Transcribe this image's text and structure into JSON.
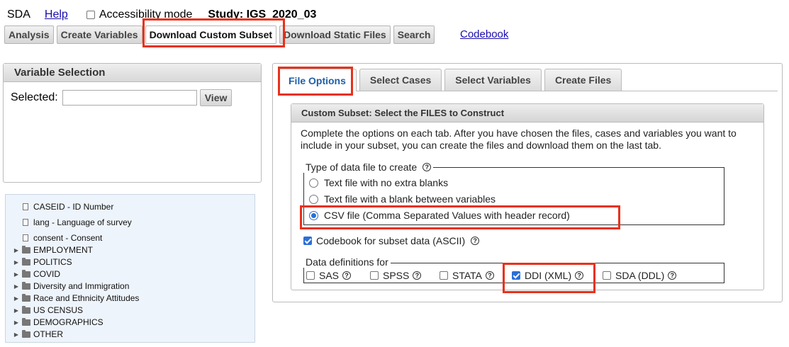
{
  "header": {
    "app_name": "SDA",
    "help_link": "Help",
    "accessibility_label": "Accessibility mode",
    "study_label": "Study: IGS_2020_03"
  },
  "toolbar": {
    "buttons": [
      "Analysis",
      "Create Variables",
      "Download Custom Subset",
      "Download Static Files",
      "Search"
    ],
    "codebook_link": "Codebook"
  },
  "variable_selection": {
    "title": "Variable Selection",
    "selected_label": "Selected:",
    "selected_value": "",
    "view_button": "View"
  },
  "tree": {
    "items": [
      {
        "label": "CASEID - ID Number",
        "kind": "variable"
      },
      {
        "label": "lang - Language of survey",
        "kind": "variable"
      },
      {
        "label": "consent - Consent",
        "kind": "variable"
      },
      {
        "label": "EMPLOYMENT",
        "kind": "folder"
      },
      {
        "label": "POLITICS",
        "kind": "folder"
      },
      {
        "label": "COVID",
        "kind": "folder"
      },
      {
        "label": "Diversity and Immigration",
        "kind": "folder"
      },
      {
        "label": "Race and Ethnicity Attitudes",
        "kind": "folder"
      },
      {
        "label": "US CENSUS",
        "kind": "folder"
      },
      {
        "label": "DEMOGRAPHICS",
        "kind": "folder"
      },
      {
        "label": "OTHER",
        "kind": "folder"
      }
    ]
  },
  "tabs": [
    "File Options",
    "Select Cases",
    "Select Variables",
    "Create Files"
  ],
  "active_tab": "File Options",
  "subset": {
    "title": "Custom Subset: Select the FILES to Construct",
    "intro_line1": "Complete the options on each tab. After you have chosen the files, cases and variables you want to",
    "intro_line2": "include in your subset, you can create the files and download them on the last tab.",
    "file_type_legend": "Type of data file to create",
    "file_types": [
      {
        "label": "Text file with no extra blanks",
        "selected": false
      },
      {
        "label": "Text file with a blank between variables",
        "selected": false
      },
      {
        "label": "CSV file (Comma Separated Values with header record)",
        "selected": true
      }
    ],
    "codebook_option": {
      "label": "Codebook for subset data (ASCII)",
      "checked": true
    },
    "defs_legend": "Data definitions for",
    "defs": [
      {
        "label": "SAS",
        "checked": false
      },
      {
        "label": "SPSS",
        "checked": false
      },
      {
        "label": "STATA",
        "checked": false
      },
      {
        "label": "DDI (XML)",
        "checked": true
      },
      {
        "label": "SDA (DDL)",
        "checked": false
      }
    ]
  },
  "colors": {
    "highlight": "#e8311a",
    "active_tab_text": "#1f5fa8",
    "link": "#1a0dab",
    "accent": "#2b6fd6"
  }
}
